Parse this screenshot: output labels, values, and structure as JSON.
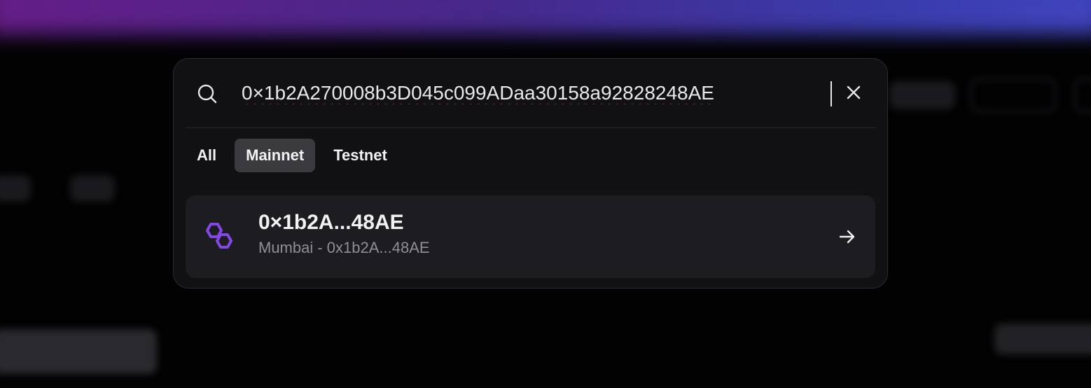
{
  "search": {
    "value": "0×1b2A270008b3D045c099ADaa30158a92828248AE",
    "icon": "search-icon",
    "clear_icon": "close-icon"
  },
  "tabs": [
    {
      "label": "All",
      "active": false
    },
    {
      "label": "Mainnet",
      "active": true
    },
    {
      "label": "Testnet",
      "active": false
    }
  ],
  "results": [
    {
      "title": "0×1b2A...48AE",
      "subtitle": "Mumbai - 0x1b2A...48AE",
      "icon": "polygon-logo-icon",
      "action_icon": "arrow-right-icon"
    }
  ],
  "colors": {
    "accent": "#8247e5",
    "modal_bg": "#111114",
    "result_bg": "#1c1c21",
    "active_tab_bg": "#3a3a3f",
    "spell_error": "#d23a3a"
  }
}
